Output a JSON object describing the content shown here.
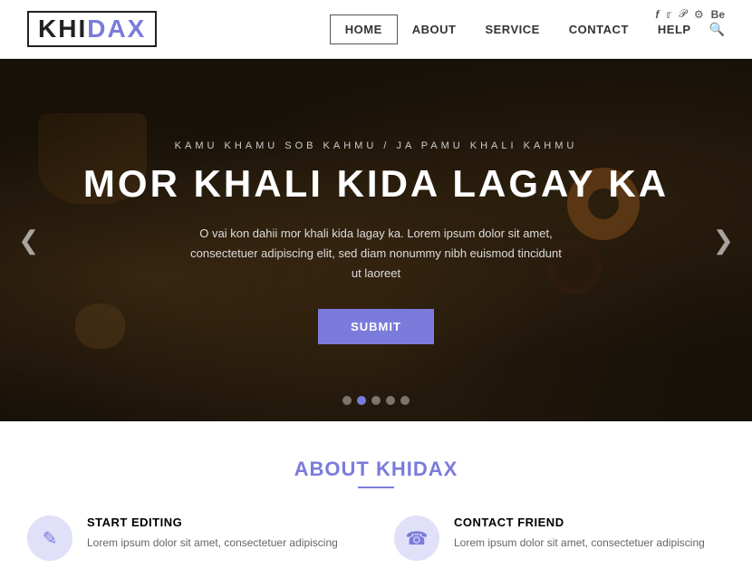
{
  "header": {
    "logo_khi": "KHI",
    "logo_dax": "DAX",
    "social": {
      "facebook": "f",
      "twitter": "t",
      "pinterest": "p",
      "settings": "⚙",
      "behance": "Be"
    },
    "nav": [
      {
        "label": "HOME",
        "active": true
      },
      {
        "label": "ABOUT",
        "active": false
      },
      {
        "label": "SERVICE",
        "active": false
      },
      {
        "label": "CONTACT",
        "active": false
      },
      {
        "label": "HELP",
        "active": false
      }
    ]
  },
  "hero": {
    "subtitle": "KAMU  KHAMU  SOB  KAHMU  /  JA  PAMU  KHALI  KAHMU",
    "title": "MOR KHALI KIDA LAGAY KA",
    "description": "O vai kon dahii mor khali kida lagay ka. Lorem ipsum dolor sit amet, consectetuer adipiscing elit, sed diam nonummy nibh euismod tincidunt ut laoreet",
    "button_label": "SUBMIT",
    "arrow_left": "❮",
    "arrow_right": "❯",
    "dots": [
      {
        "active": false
      },
      {
        "active": true
      },
      {
        "active": false
      },
      {
        "active": false
      },
      {
        "active": false
      }
    ]
  },
  "about": {
    "title_khi": "ABOUT KHI",
    "title_dax": "DAX",
    "cards": [
      {
        "icon": "✎",
        "heading": "START EDITING",
        "text": "Lorem ipsum dolor sit amet, consectetuer adipiscing"
      },
      {
        "icon": "☎",
        "heading": "CONTACT FRIEND",
        "text": "Lorem ipsum dolor sit amet, consectetuer adipiscing"
      }
    ]
  }
}
